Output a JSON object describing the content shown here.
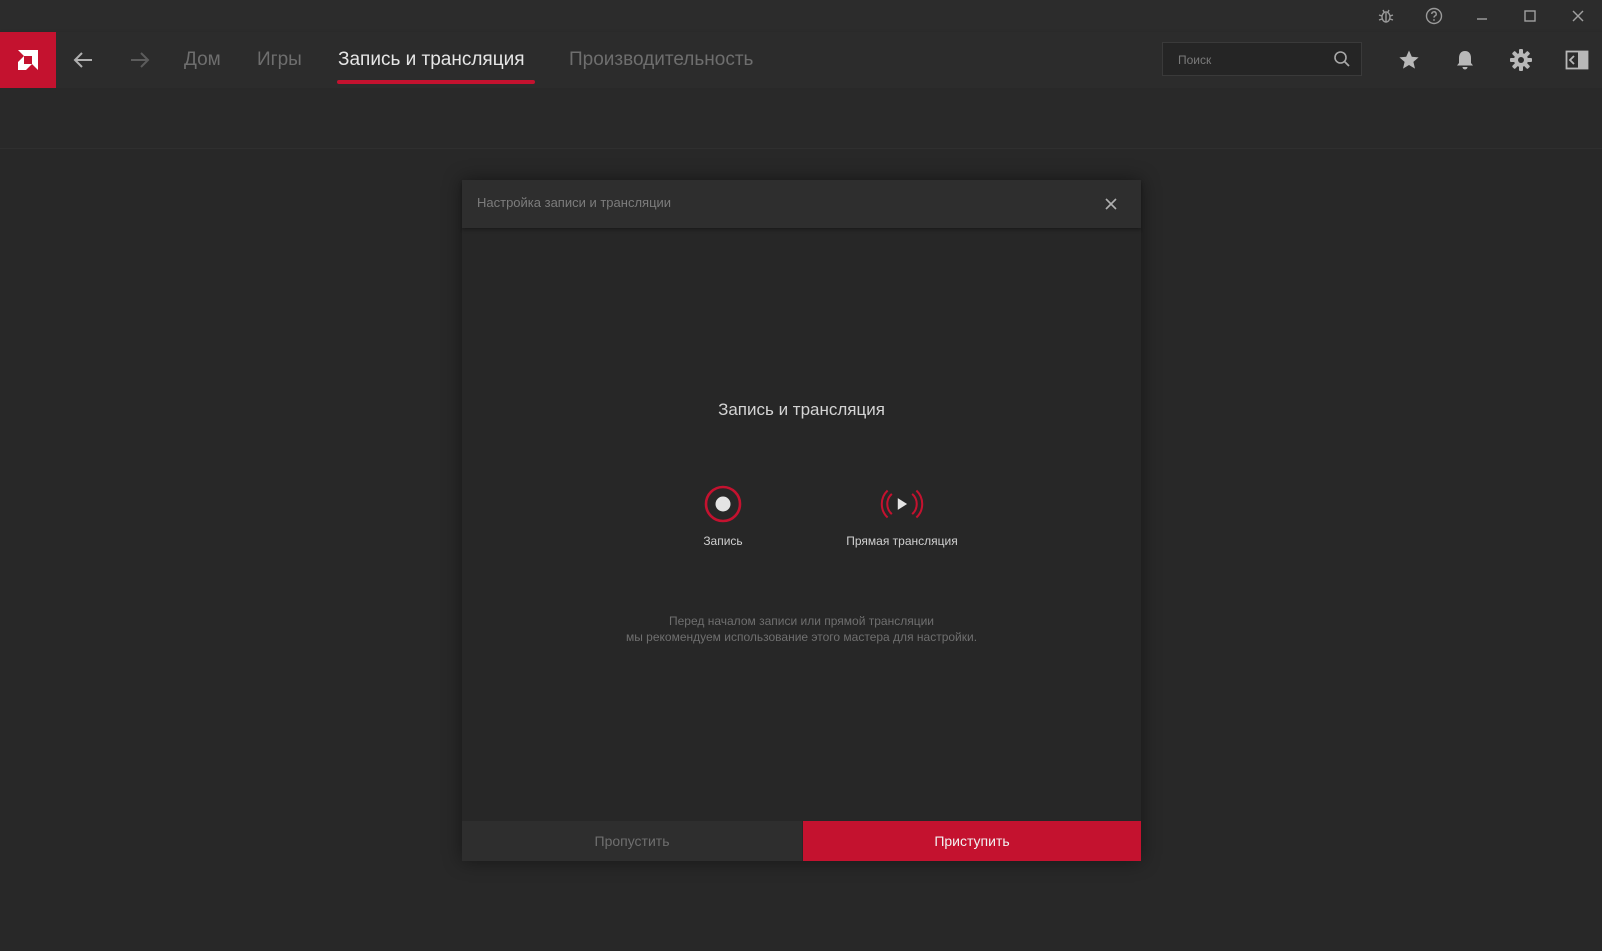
{
  "nav": {
    "tabs": [
      {
        "label": "Дом"
      },
      {
        "label": "Игры"
      },
      {
        "label": "Запись и трансляция"
      },
      {
        "label": "Производительность"
      }
    ],
    "search_placeholder": "Поиск"
  },
  "titlebar_icons": [
    "bug-icon",
    "help-icon",
    "minimize-icon",
    "maximize-icon",
    "close-icon"
  ],
  "nav_icons": [
    "amd-logo",
    "back-arrow-icon",
    "forward-arrow-icon",
    "search-icon",
    "star-icon",
    "bell-icon",
    "gear-icon",
    "sidebar-toggle-icon"
  ],
  "dialog": {
    "title": "Настройка записи и трансляции",
    "heading": "Запись и трансляция",
    "options": [
      {
        "label": "Запись",
        "icon": "record-icon"
      },
      {
        "label": "Прямая трансляция",
        "icon": "live-stream-icon"
      }
    ],
    "hint_line1": "Перед началом записи или прямой трансляции",
    "hint_line2": "мы рекомендуем использование этого мастера для настройки.",
    "skip_label": "Пропустить",
    "start_label": "Приступить"
  },
  "colors": {
    "accent": "#c4122f",
    "background": "#282828",
    "bar": "#2c2c2c"
  }
}
